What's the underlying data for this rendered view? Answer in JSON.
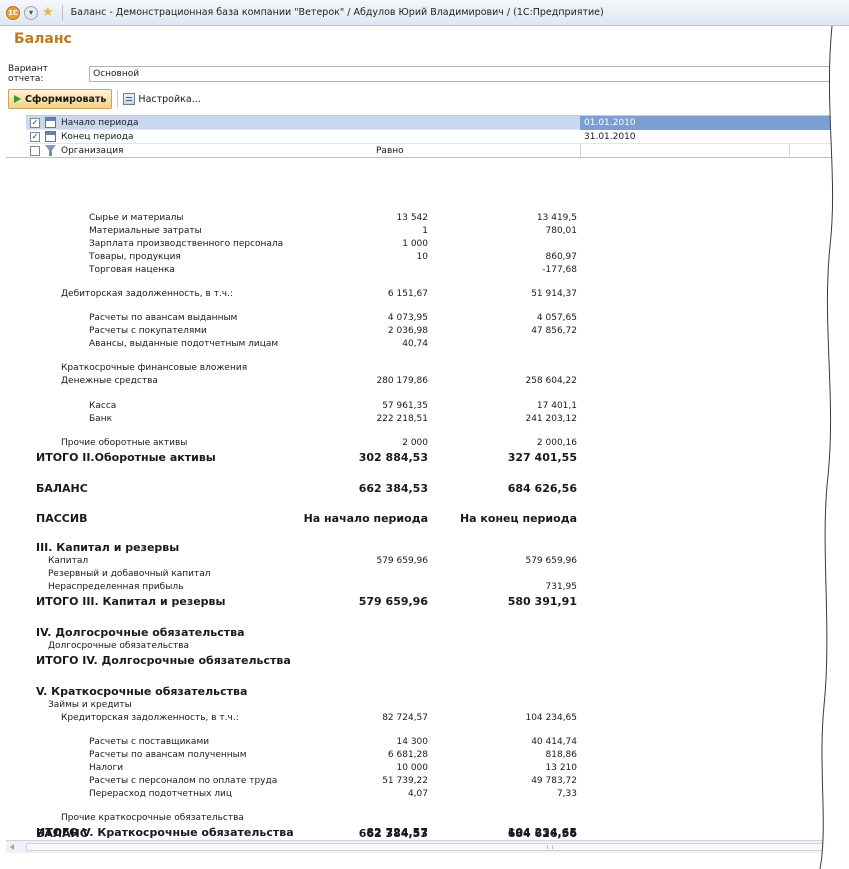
{
  "window_title": "Баланс - Демонстрационная база компании \"Ветерок\" / Абдулов Юрий Владимирович /  (1С:Предприятие)",
  "titlebar": {
    "logo": "1С"
  },
  "document_title": "Баланс",
  "variant": {
    "label": "Вариант отчета:",
    "value": "Основной"
  },
  "toolbar": {
    "run_label": "Сформировать",
    "settings_label": "Настройка..."
  },
  "filters": [
    {
      "checked": true,
      "check_mark": "✓",
      "label": "Начало периода",
      "condition": "",
      "value": "01.01.2010"
    },
    {
      "checked": true,
      "check_mark": "✓",
      "label": "Конец периода",
      "condition": "",
      "value": "31.01.2010"
    },
    {
      "checked": false,
      "check_mark": "",
      "label": "Организация",
      "condition": "Равно",
      "value": ""
    }
  ],
  "report_rows": [
    {
      "label": "Сырье и материалы",
      "v1": "13 542",
      "v2": "13 419,5"
    },
    {
      "label": "Материальные затраты",
      "v1": "1",
      "v2": "780,01"
    },
    {
      "label": "Зарплата производственного персонала",
      "v1": "1 000",
      "v2": ""
    },
    {
      "label": "Товары, продукция",
      "v1": "10",
      "v2": "860,97"
    },
    {
      "label": "Торговая наценка",
      "v1": "",
      "v2": "-177,68"
    },
    {
      "label": "Дебиторская задолженность, в т.ч.:",
      "v1": "6 151,67",
      "v2": "51 914,37"
    },
    {
      "label": "Расчеты по авансам выданным",
      "v1": "4 073,95",
      "v2": "4 057,65"
    },
    {
      "label": "Расчеты с покупателями",
      "v1": "2 036,98",
      "v2": "47 856,72"
    },
    {
      "label": "Авансы, выданные подотчетным лицам",
      "v1": "40,74",
      "v2": ""
    },
    {
      "label": "Краткосрочные финансовые вложения",
      "v1": "",
      "v2": ""
    },
    {
      "label": "Денежные средства",
      "v1": "280 179,86",
      "v2": "258 604,22"
    },
    {
      "label": "Касса",
      "v1": "57 961,35",
      "v2": "17 401,1"
    },
    {
      "label": "Банк",
      "v1": "222 218,51",
      "v2": "241 203,12"
    },
    {
      "label": "Прочие оборотные активы",
      "v1": "2 000",
      "v2": "2 000,16"
    },
    {
      "label": "ИТОГО II.Оборотные активы",
      "v1": "302 884,53",
      "v2": "327 401,55"
    },
    {
      "label": "БАЛАНС",
      "v1": "662 384,53",
      "v2": "684 626,56"
    },
    {
      "label": "ПАССИВ",
      "v1": "На начало периода",
      "v2": "На конец периода"
    },
    {
      "label": "III. Капитал и резервы",
      "v1": "",
      "v2": ""
    },
    {
      "label": "Капитал",
      "v1": "579 659,96",
      "v2": "579 659,96"
    },
    {
      "label": "Резервный и добавочный капитал",
      "v1": "",
      "v2": ""
    },
    {
      "label": "Нераспределенная прибыль",
      "v1": "",
      "v2": "731,95"
    },
    {
      "label": "ИТОГО III. Капитал и резервы",
      "v1": "579 659,96",
      "v2": "580 391,91"
    },
    {
      "label": "IV. Долгосрочные обязательства",
      "v1": "",
      "v2": ""
    },
    {
      "label": "Долгосрочные обязательства",
      "v1": "",
      "v2": ""
    },
    {
      "label": "ИТОГО IV. Долгосрочные обязательства",
      "v1": "",
      "v2": ""
    },
    {
      "label": "V. Краткосрочные обязательства",
      "v1": "",
      "v2": ""
    },
    {
      "label": "Займы и кредиты",
      "v1": "",
      "v2": ""
    },
    {
      "label": "Кредиторская задолженность, в т.ч.:",
      "v1": "82 724,57",
      "v2": "104 234,65"
    },
    {
      "label": "Расчеты с поставщиками",
      "v1": "14 300",
      "v2": "40 414,74"
    },
    {
      "label": "Расчеты по авансам полученным",
      "v1": "6 681,28",
      "v2": "818,86"
    },
    {
      "label": "Налоги",
      "v1": "10 000",
      "v2": "13 210"
    },
    {
      "label": "Расчеты с персоналом по оплате труда",
      "v1": "51 739,22",
      "v2": "49 783,72"
    },
    {
      "label": "Перерасход подотчетных лиц",
      "v1": "4,07",
      "v2": "7,33"
    },
    {
      "label": "Прочие краткосрочные обязательства",
      "v1": "",
      "v2": ""
    },
    {
      "label": "ИТОГО V. Краткосрочные обязательства",
      "v1": "82 724,57",
      "v2": "104 234,65"
    },
    {
      "label": "БАЛАНС",
      "v1": "662 384,53",
      "v2": "684 626,56"
    }
  ]
}
